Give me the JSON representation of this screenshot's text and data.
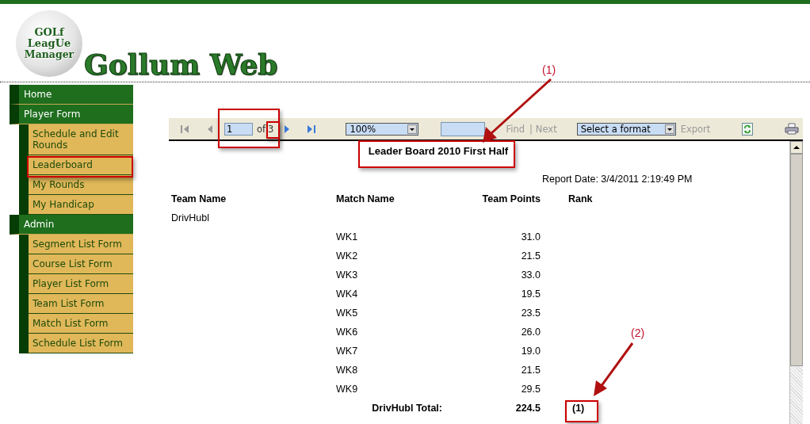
{
  "header": {
    "logo_lines": [
      "GOLf",
      "LeagUe",
      "Manager"
    ],
    "site_title": "Gollum Web"
  },
  "nav": [
    {
      "label": "Home"
    },
    {
      "label": "Player Form",
      "children": [
        {
          "label": "Schedule and Edit Rounds"
        },
        {
          "label": "Leaderboard"
        },
        {
          "label": "My Rounds"
        },
        {
          "label": "My Handicap"
        }
      ]
    },
    {
      "label": "Admin",
      "children": [
        {
          "label": "Segment List Form"
        },
        {
          "label": "Course List Form"
        },
        {
          "label": "Player List Form"
        },
        {
          "label": "Team List Form"
        },
        {
          "label": "Match List Form"
        },
        {
          "label": "Schedule List Form"
        }
      ]
    }
  ],
  "toolbar": {
    "pager": [
      {
        "kind": "first",
        "disabled": true
      },
      {
        "kind": "prev",
        "disabled": true
      },
      {
        "kind": "next",
        "disabled": false
      },
      {
        "kind": "last",
        "disabled": false
      }
    ],
    "page": "1",
    "of_label": "of",
    "page_count": "3",
    "zoom": "100%",
    "find_label": "Find",
    "separator": "|",
    "next_label": "Next",
    "format": "Select a format",
    "export_label": "Export"
  },
  "report": {
    "title": "Leader Board 2010 First Half",
    "report_date": "Report Date: 3/4/2011 2:19:49 PM",
    "columns": [
      "Team Name",
      "Match Name",
      "Team Points",
      "Rank"
    ],
    "team": "DrivHubl",
    "rows": [
      {
        "match": "WK1",
        "points": "31.0"
      },
      {
        "match": "WK2",
        "points": "21.5"
      },
      {
        "match": "WK3",
        "points": "33.0"
      },
      {
        "match": "WK4",
        "points": "19.5"
      },
      {
        "match": "WK5",
        "points": "23.5"
      },
      {
        "match": "WK6",
        "points": "26.0"
      },
      {
        "match": "WK7",
        "points": "19.0"
      },
      {
        "match": "WK8",
        "points": "21.5"
      },
      {
        "match": "WK9",
        "points": "29.5"
      }
    ],
    "total_label": "DrivHubl Total:",
    "total_points": "224.5",
    "total_rank": "(1)"
  },
  "annotations": [
    {
      "label": "(1)"
    },
    {
      "label": "(2)"
    }
  ]
}
